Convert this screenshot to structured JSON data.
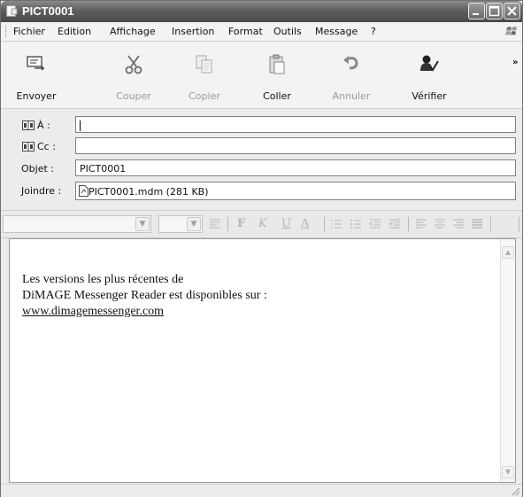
{
  "window": {
    "title": "PICT0001",
    "controls": [
      "minimize",
      "maximize",
      "close"
    ]
  },
  "menu": {
    "items": [
      "Fichier",
      "Edition",
      "Affichage",
      "Insertion",
      "Format",
      "Outils",
      "Message",
      "?"
    ]
  },
  "toolbar": {
    "send_label": "Envoyer",
    "cut_label": "Couper",
    "copy_label": "Copier",
    "paste_label": "Coller",
    "undo_label": "Annuler",
    "check_label": "Vérifier",
    "more": "»"
  },
  "header": {
    "to_label": "À :",
    "to_value": "",
    "cc_label": "Cc :",
    "cc_value": "",
    "subject_label": "Objet :",
    "subject_value": "PICT0001",
    "attach_label": "Joindre :",
    "attachment": "PICT0001.mdm (281 KB)"
  },
  "format_toolbar": {
    "bold": "F",
    "italic": "K",
    "underline": "U",
    "font_color": "A"
  },
  "body": {
    "line1": "Les versions les plus récentes de",
    "line2": "DiMAGE Messenger Reader est disponibles sur :",
    "link": "www.dimagemessenger.com"
  }
}
